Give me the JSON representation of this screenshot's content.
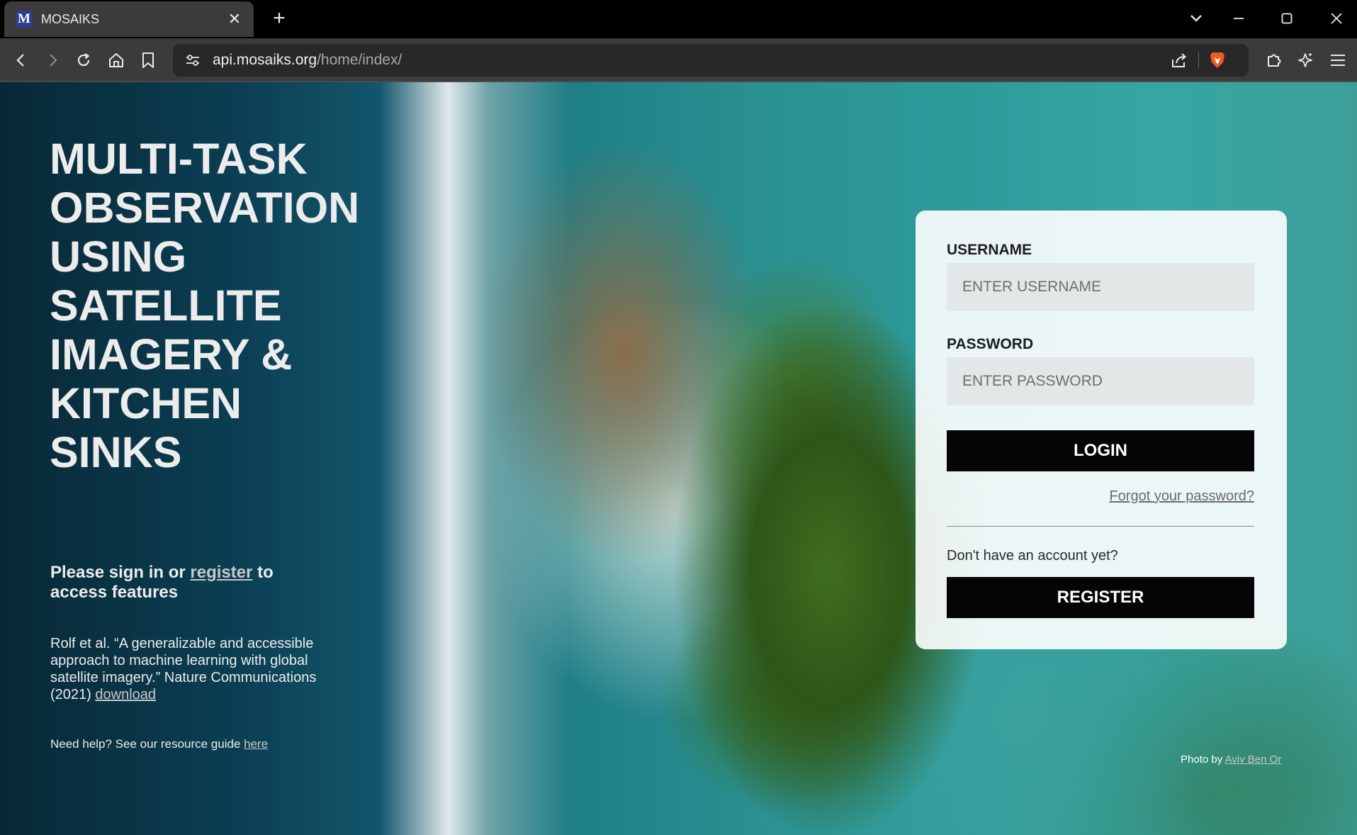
{
  "browser": {
    "tab_favicon_letter": "M",
    "tab_title": "MOSAIKS",
    "tab_close": "✕",
    "new_tab": "+",
    "url_host": "api.mosaiks.org",
    "url_path": "/home/index/"
  },
  "hero": {
    "title_lines": [
      "MULTI-TASK",
      "OBSERVATION",
      "USING",
      "SATELLITE",
      "IMAGERY &",
      "KITCHEN",
      "SINKS"
    ]
  },
  "signin": {
    "prefix": "Please sign in or ",
    "register_link": "register",
    "suffix": " to access features"
  },
  "citation": {
    "text": "Rolf et al. “A generalizable and accessible approach to machine learning with global satellite imagery.” Nature Communications (2021) ",
    "download_link": "download"
  },
  "help": {
    "text": "Need help? See our resource guide ",
    "link": "here"
  },
  "photo_credit": {
    "prefix": "Photo by ",
    "author": "Aviv Ben Or"
  },
  "login_form": {
    "username_label": "USERNAME",
    "username_placeholder": "ENTER USERNAME",
    "password_label": "PASSWORD",
    "password_placeholder": "ENTER PASSWORD",
    "login_button": "LOGIN",
    "forgot_password": "Forgot your password?",
    "no_account": "Don't have an account yet?",
    "register_button": "REGISTER"
  }
}
